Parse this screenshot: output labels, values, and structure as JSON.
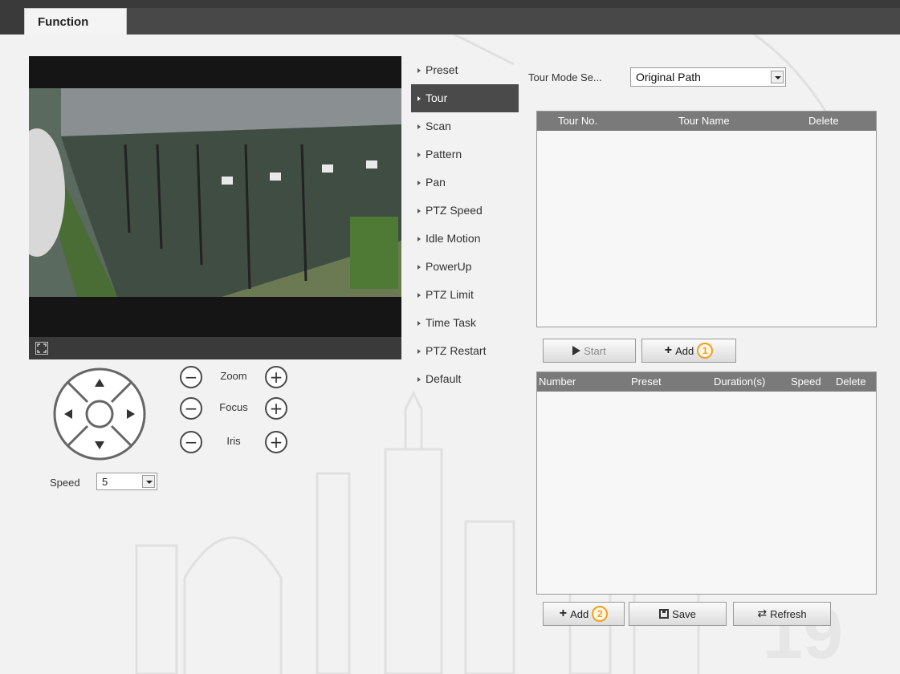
{
  "header": {
    "tab_function": "Function"
  },
  "video": {
    "fullscreen_icon": "fullscreen-icon"
  },
  "ptz": {
    "zoom_label": "Zoom",
    "focus_label": "Focus",
    "iris_label": "Iris",
    "minus": "−",
    "plus": "+",
    "speed_label": "Speed",
    "speed_value": "5"
  },
  "menu": {
    "items": [
      {
        "label": "Preset"
      },
      {
        "label": "Tour"
      },
      {
        "label": "Scan"
      },
      {
        "label": "Pattern"
      },
      {
        "label": "Pan"
      },
      {
        "label": "PTZ Speed"
      },
      {
        "label": "Idle Motion"
      },
      {
        "label": "PowerUp"
      },
      {
        "label": "PTZ Limit"
      },
      {
        "label": "Time Task"
      },
      {
        "label": "PTZ Restart"
      },
      {
        "label": "Default"
      }
    ],
    "active": "Tour"
  },
  "tour": {
    "mode_label": "Tour Mode Se...",
    "mode_value": "Original Path",
    "columns": [
      "Tour No.",
      "Tour Name",
      "Delete"
    ],
    "start_label": "Start",
    "add_label": "Add",
    "add_badge": "1"
  },
  "presets": {
    "columns": [
      "Number",
      "Preset",
      "Duration(s)",
      "Speed",
      "Delete"
    ],
    "add_label": "Add",
    "add_badge": "2",
    "save_label": "Save",
    "refresh_label": "Refresh"
  },
  "colors": {
    "header_bg": "#3a3a3a",
    "active_menu": "#4a4a4a",
    "badge": "#f0a020"
  }
}
